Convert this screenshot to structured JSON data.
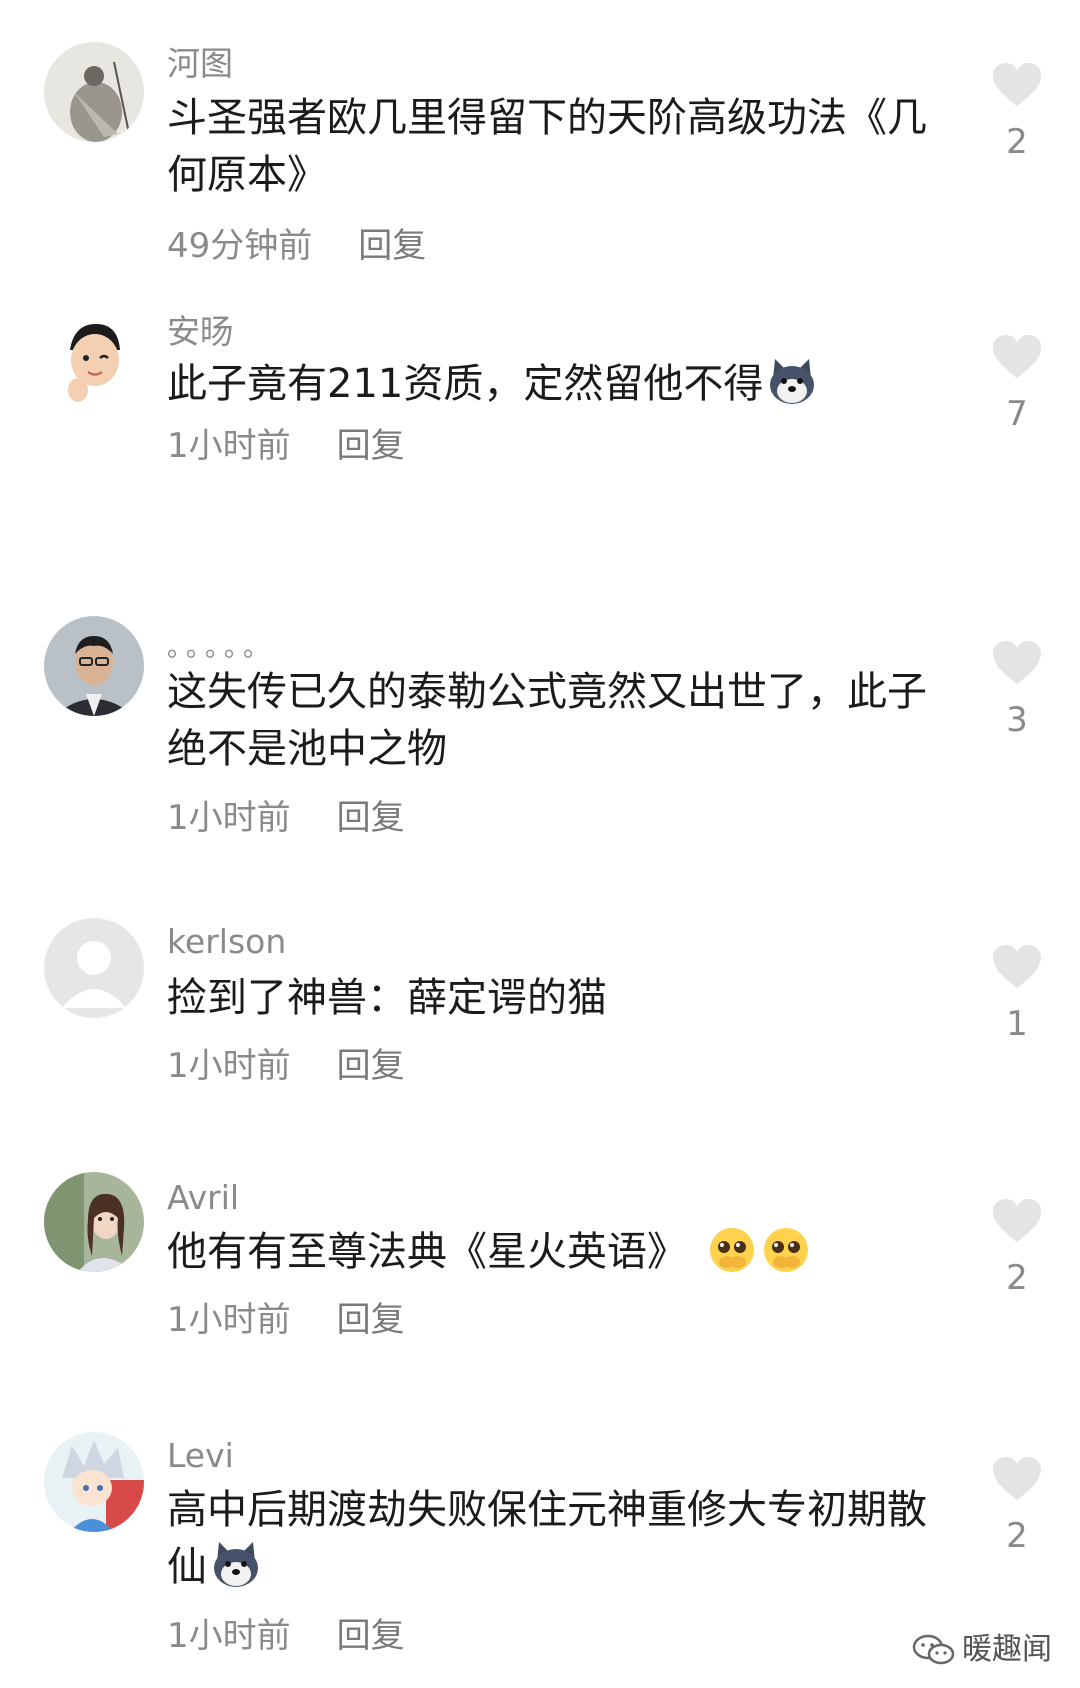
{
  "comments": [
    {
      "username": "河图",
      "text": "斗圣强者欧几里得留下的天阶高级功法《几何原本》",
      "time": "49分钟前",
      "reply": "回复",
      "likes": "2"
    },
    {
      "username": "安旸",
      "text": "此子竟有211资质，定然留他不得",
      "time": "1小时前",
      "reply": "回复",
      "likes": "7",
      "emoji": "husky-emoji"
    },
    {
      "username": "。。。。。",
      "text": "这失传已久的泰勒公式竟然又出世了，此子绝不是池中之物",
      "time": "1小时前",
      "reply": "回复",
      "likes": "3"
    },
    {
      "username": "kerlson",
      "text": "捡到了神兽：薛定谔的猫",
      "time": "1小时前",
      "reply": "回复",
      "likes": "1"
    },
    {
      "username": "Avril",
      "text": "他有有至尊法典《星火英语》",
      "time": "1小时前",
      "reply": "回复",
      "likes": "2",
      "emoji": "pleading-face-emoji ×2"
    },
    {
      "username": "Levi",
      "text": "高中后期渡劫失败保住元神重修大专初期散仙",
      "time": "1小时前",
      "reply": "回复",
      "likes": "2",
      "emoji": "husky-emoji"
    }
  ],
  "watermark": "暖趣闻",
  "icons": {
    "like": "heart-icon",
    "watermark": "wechat-icon"
  },
  "colors": {
    "text": "#1b1b1b",
    "secondary": "#8a8a8a",
    "heart": "#e4e4e4"
  }
}
